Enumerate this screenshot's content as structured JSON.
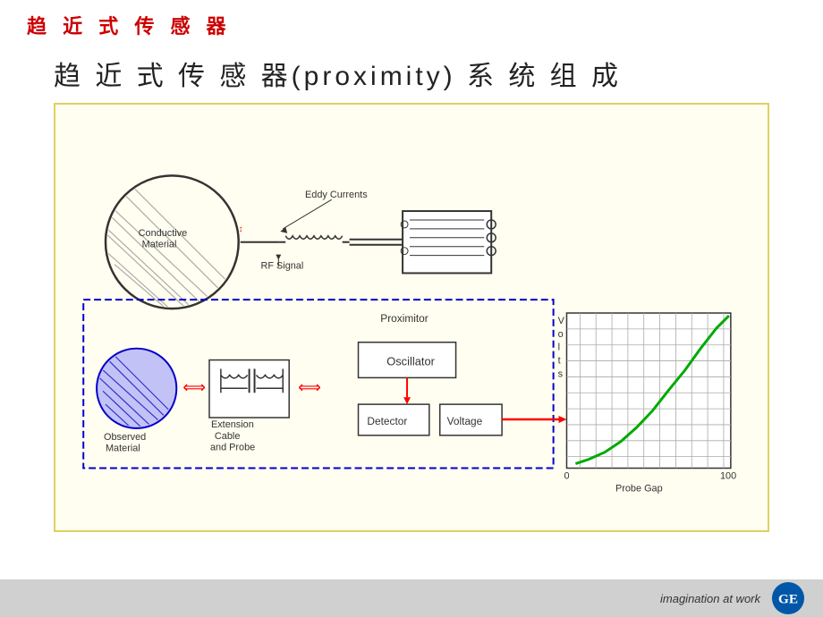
{
  "header": {
    "top_title": "趋 近 式 传 感 器",
    "main_heading": "趋 近 式 传 感 器(proximity) 系 统 组 成"
  },
  "diagram": {
    "labels": {
      "eddy_currents": "Eddy Currents",
      "conductive_material": "Conductive\nMaterial",
      "rf_signal": "RF Signal",
      "observed_material": "Observed\nMaterial",
      "extension_cable": "Extension\nCable\nand Probe",
      "proximitor": "Proximitor",
      "oscillator": "Oscillator",
      "detector": "Detector",
      "voltage": "Voltage",
      "volts": "V\no\nl\nt\ns",
      "probe_gap": "Probe Gap",
      "zero": "0",
      "hundred": "100"
    }
  },
  "footer": {
    "tagline": "imagination at work"
  }
}
